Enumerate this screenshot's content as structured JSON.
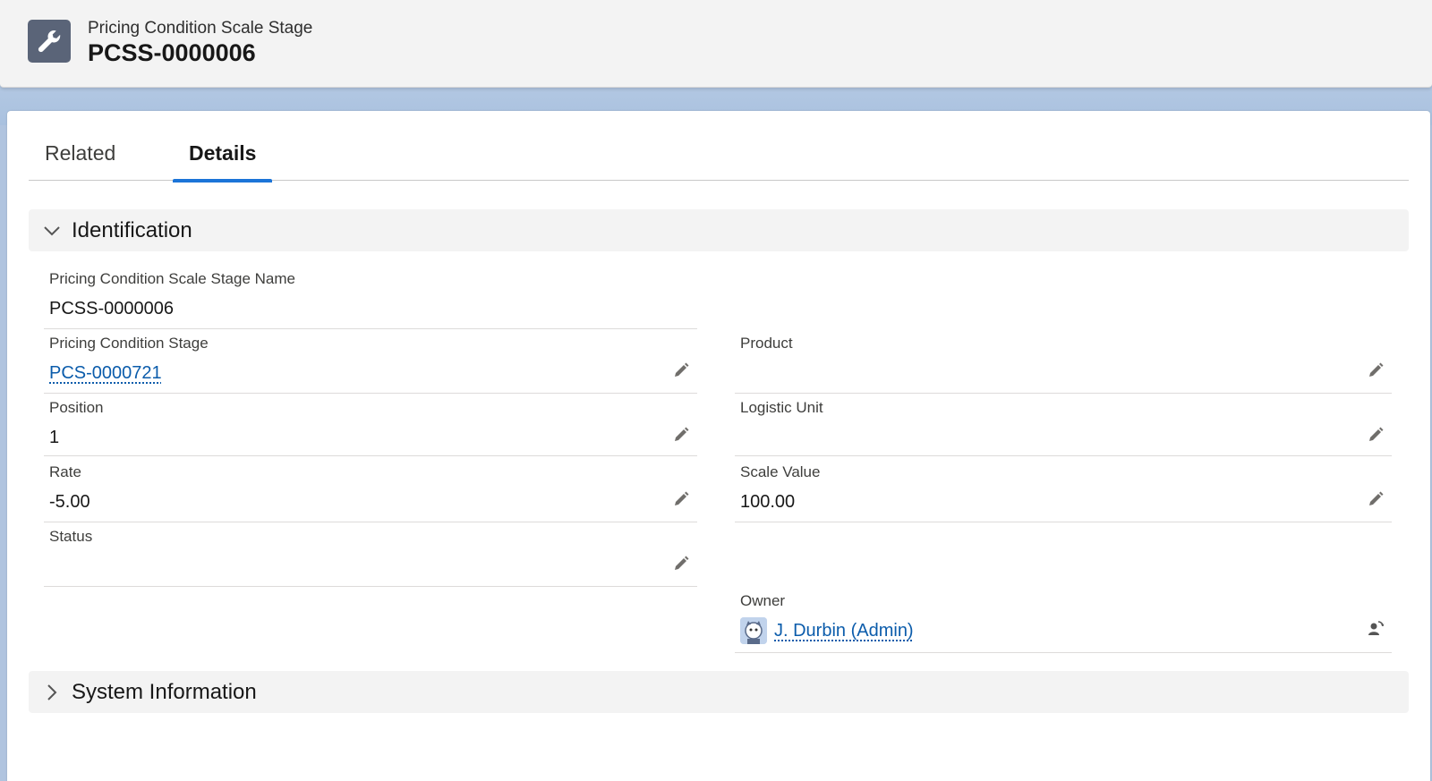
{
  "header": {
    "object_type": "Pricing Condition Scale Stage",
    "record_title": "PCSS-0000006",
    "icon": "wrench-icon"
  },
  "tabs": [
    {
      "label": "Related",
      "active": false
    },
    {
      "label": "Details",
      "active": true
    }
  ],
  "sections": {
    "identification": {
      "label": "Identification",
      "expanded": true,
      "fields": {
        "name": {
          "label": "Pricing Condition Scale Stage Name",
          "value": "PCSS-0000006"
        },
        "pricing_condition_stage": {
          "label": "Pricing Condition Stage",
          "value": "PCS-0000721"
        },
        "product": {
          "label": "Product",
          "value": ""
        },
        "position": {
          "label": "Position",
          "value": "1"
        },
        "logistic_unit": {
          "label": "Logistic Unit",
          "value": ""
        },
        "rate": {
          "label": "Rate",
          "value": "-5.00"
        },
        "scale_value": {
          "label": "Scale Value",
          "value": "100.00"
        },
        "status": {
          "label": "Status",
          "value": ""
        },
        "owner": {
          "label": "Owner",
          "value": "J. Durbin (Admin)"
        }
      }
    },
    "system_information": {
      "label": "System Information",
      "expanded": false
    }
  },
  "colors": {
    "accent": "#1b74d8",
    "link": "#0b5cab",
    "icon_bg": "#5a6478"
  }
}
